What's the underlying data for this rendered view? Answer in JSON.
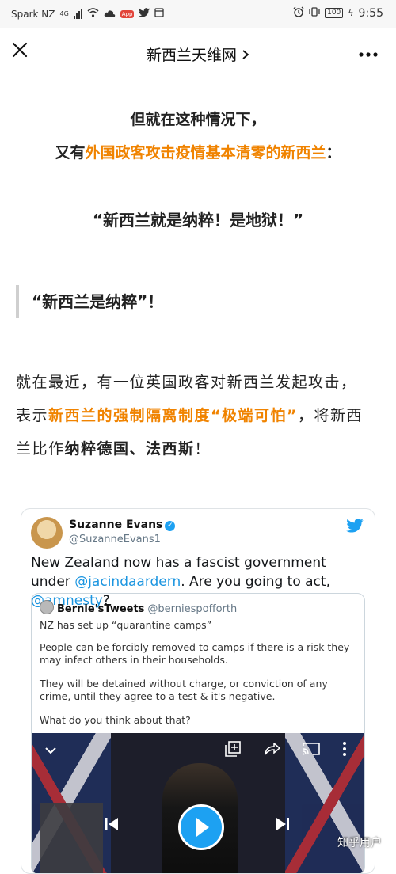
{
  "status_bar": {
    "carrier": "Spark NZ",
    "network": "4G",
    "battery": "100",
    "time": "9:55"
  },
  "nav": {
    "title": "新西兰天维网"
  },
  "article": {
    "line1": "但就在这种情况下，",
    "line2_prefix": "又有",
    "line2_highlight": "外国政客攻击疫情基本清零的新西兰",
    "line2_suffix": "：",
    "headline_quote": "“新西兰就是纳粹！是地狱！”",
    "section_quote": "“新西兰是纳粹”！",
    "para_1a": "就在最近，有一位英国政客对新西兰发起攻击，",
    "para_2a": "表示",
    "para_2b_highlight": "新西兰的强制隔离制度“极端可怕”",
    "para_2c": "，将新西",
    "para_3a": "兰比作",
    "para_3b_bold": "纳粹德国、法西斯",
    "para_3c": "！"
  },
  "tweet": {
    "name": "Suzanne Evans",
    "handle": "@SuzanneEvans1",
    "text_1": "New Zealand now has a fascist government under ",
    "mention_1": "@jacindaardern",
    "text_2": ". Are you going to act, ",
    "mention_2": "@amnesty",
    "text_3": "?",
    "quoted": {
      "name": "Bernie'sTweets",
      "handle": "@berniespofforth",
      "p1": "NZ has set up “quarantine camps”",
      "p2": "People can be forcibly removed to camps if there is a risk they may infect others in their households.",
      "p3": "They will be detained without charge, or conviction of any crime, until they agree to a test & it's negative.",
      "p4": "What do you think about that?"
    }
  },
  "watermark": "知乎用户",
  "colors": {
    "highlight": "#f08300",
    "twitter_blue": "#1da1f2"
  }
}
